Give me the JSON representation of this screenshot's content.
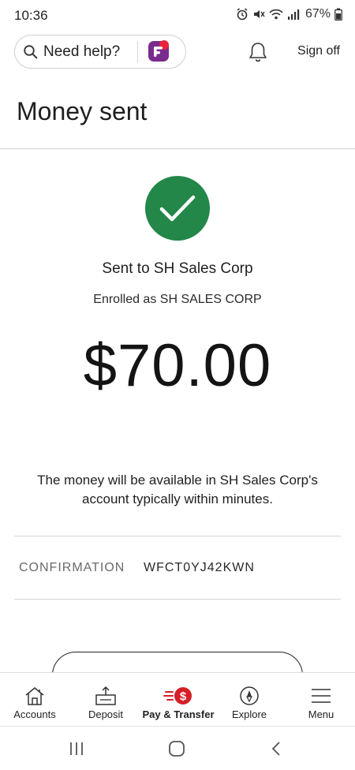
{
  "status_bar": {
    "time": "10:36",
    "battery": "67%"
  },
  "header": {
    "search_placeholder": "Need help?",
    "sign_off_label": "Sign off"
  },
  "page": {
    "title": "Money sent",
    "sent_to": "Sent to SH Sales Corp",
    "enrolled_as": "Enrolled as SH SALES CORP",
    "amount": "$70.00",
    "availability_message": "The money will be available in SH Sales Corp's account typically within minutes.",
    "confirmation_label": "CONFIRMATION",
    "confirmation_number": "WFCT0YJ42KWN",
    "success_color": "#228749"
  },
  "bottom_nav": {
    "items": [
      {
        "label": "Accounts",
        "icon": "home-icon"
      },
      {
        "label": "Deposit",
        "icon": "deposit-icon"
      },
      {
        "label": "Pay & Transfer",
        "icon": "pay-transfer-icon",
        "active": true
      },
      {
        "label": "Explore",
        "icon": "compass-icon"
      },
      {
        "label": "Menu",
        "icon": "hamburger-icon"
      }
    ],
    "accent_color": "#d71e28"
  },
  "system_nav": {
    "buttons": [
      "recent-apps",
      "home",
      "back"
    ]
  }
}
